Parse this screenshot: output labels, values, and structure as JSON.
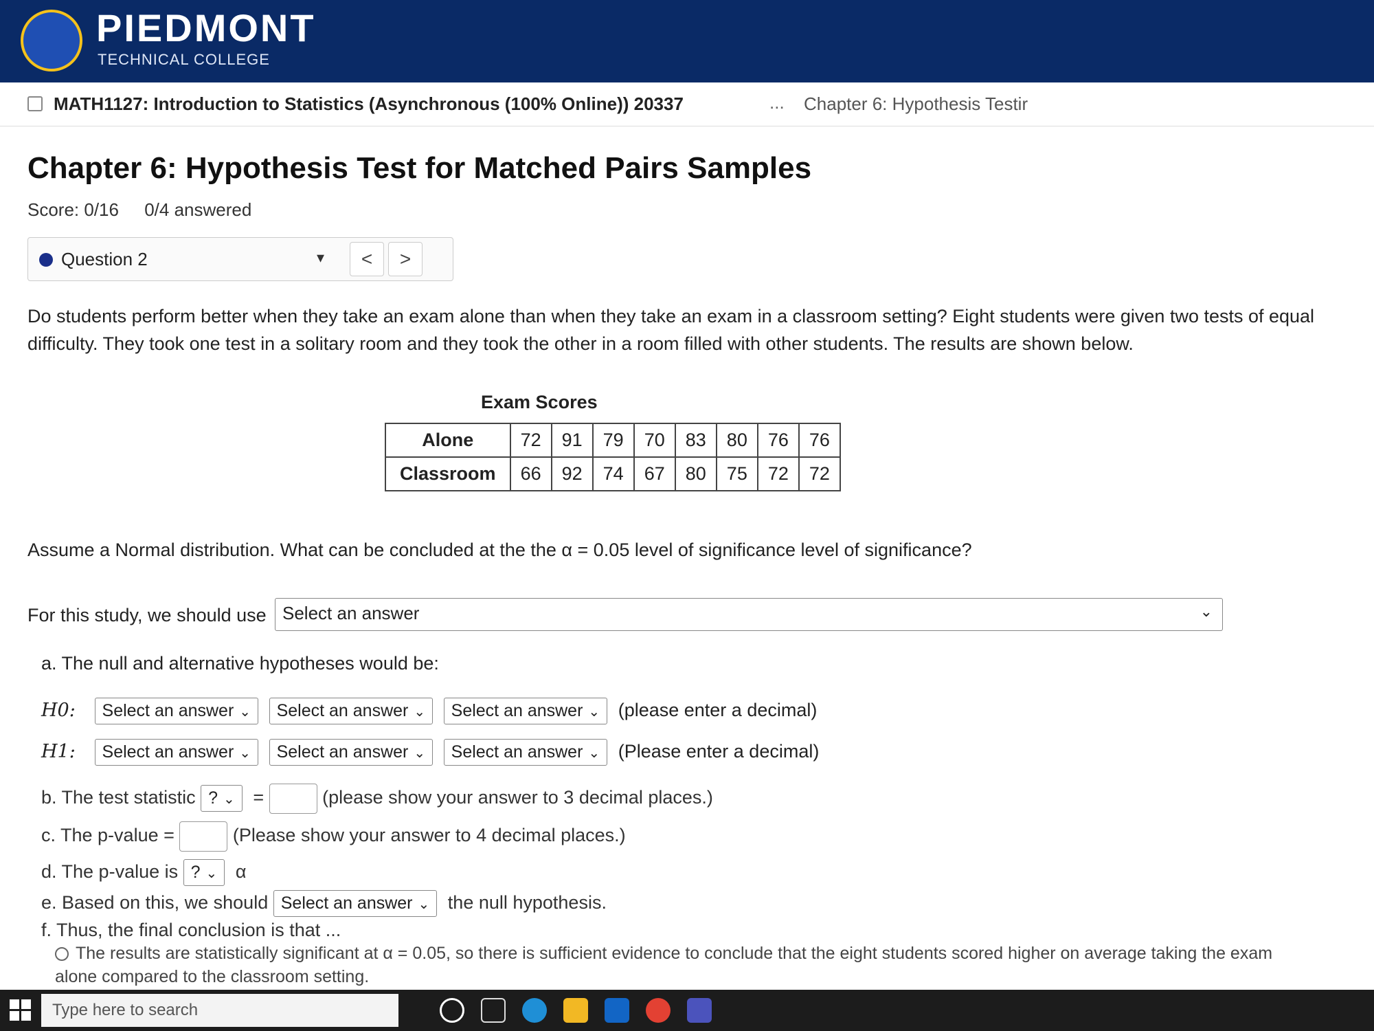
{
  "brand": {
    "name": "PIEDMONT",
    "sub": "TECHNICAL COLLEGE"
  },
  "breadcrumb": {
    "course": "MATH1127: Introduction to Statistics (Asynchronous (100% Online)) 20337",
    "ellipsis": "...",
    "current": "Chapter 6: Hypothesis Testir"
  },
  "page": {
    "title": "Chapter 6: Hypothesis Test for Matched Pairs Samples",
    "score": "Score: 0/16",
    "answered": "0/4 answered"
  },
  "question_nav": {
    "label": "Question 2",
    "caret": "▾",
    "prev": "<",
    "next": ">"
  },
  "question": {
    "text": "Do students perform better when they take an exam alone than when they take an exam in a classroom setting? Eight students were given two tests of equal difficulty. They took one test in a solitary room and they took the other in a room filled with other students. The results are shown below.",
    "table_title": "Exam Scores",
    "table": [
      {
        "label": "Alone",
        "values": [
          "72",
          "91",
          "79",
          "70",
          "83",
          "80",
          "76",
          "76"
        ]
      },
      {
        "label": "Classroom",
        "values": [
          "66",
          "92",
          "74",
          "67",
          "80",
          "75",
          "72",
          "72"
        ]
      }
    ],
    "assume": "Assume a Normal distribution. What can be concluded at the the α = 0.05 level of significance level of significance?",
    "use_prefix": "For this study, we should use",
    "use_select": "Select an answer",
    "part_a": "a. The null and alternative hypotheses would be:",
    "h0_symbol": "H0:",
    "h1_symbol": "H1:",
    "select_answer": "Select an answer",
    "h0_note": "(please enter a decimal)",
    "h1_note": "(Please enter a decimal)",
    "part_b_prefix": "b. The test statistic",
    "q_select": "?",
    "equals": "=",
    "part_b_note": "(please show your answer to 3 decimal places.)",
    "part_c_prefix": "c. The p-value =",
    "part_c_note": "(Please show your answer to 4 decimal places.)",
    "part_d_prefix": "d. The p-value is",
    "alpha": "α",
    "part_e_prefix": "e. Based on this, we should",
    "part_e_suffix": "the null hypothesis.",
    "part_f": "f. Thus, the final conclusion is that ...",
    "final_option": "The results are statistically significant at α = 0.05, so there is sufficient evidence to conclude that the eight students scored higher on average taking the exam alone compared to the classroom setting."
  },
  "taskbar": {
    "search_placeholder": "Type here to search"
  }
}
